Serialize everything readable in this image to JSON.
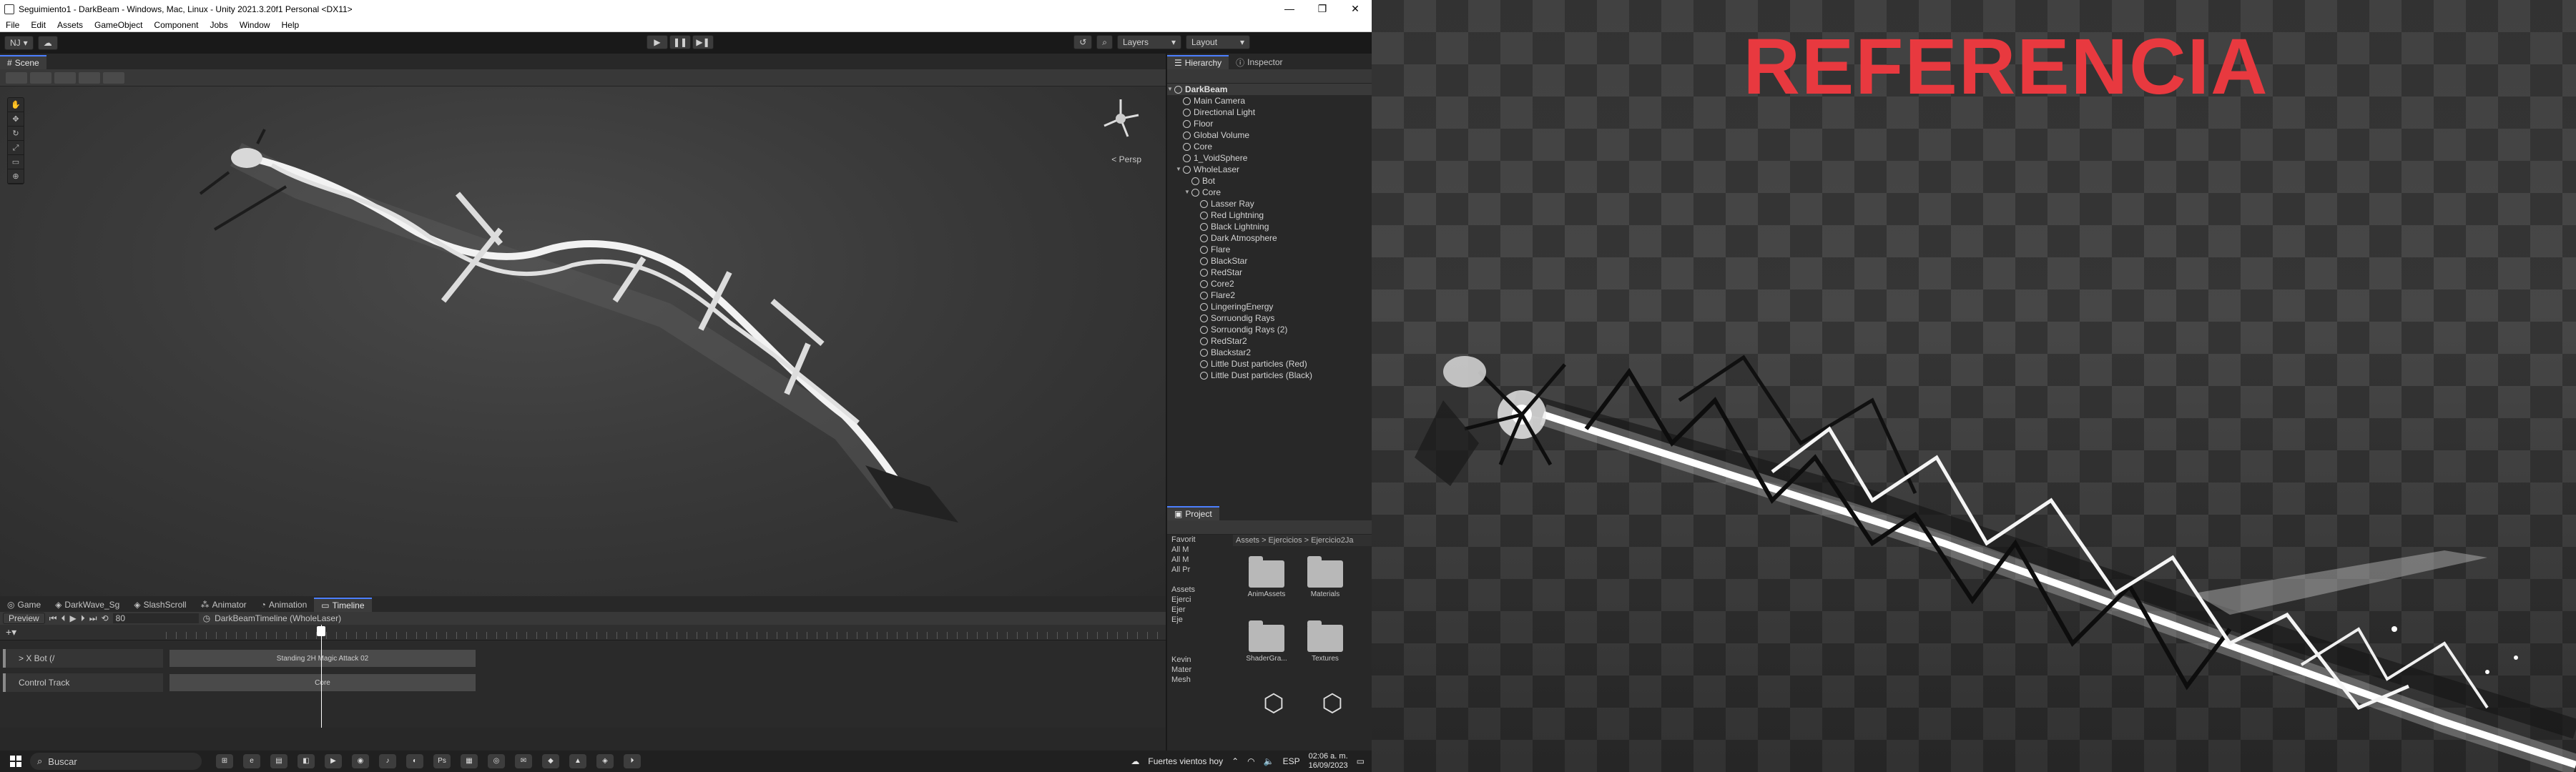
{
  "window": {
    "title": "Seguimiento1 - DarkBeam - Windows, Mac, Linux - Unity 2021.3.20f1 Personal <DX11>",
    "controls": [
      "—",
      "❐",
      "✕"
    ]
  },
  "menu": [
    "File",
    "Edit",
    "Assets",
    "GameObject",
    "Component",
    "Jobs",
    "Window",
    "Help"
  ],
  "toolbar": {
    "account": "NJ",
    "layers_label": "Layers",
    "layout_label": "Layout"
  },
  "scene": {
    "tab_label": "Scene",
    "persp_label": "< Persp"
  },
  "bottom_tabs": [
    "Game",
    "DarkWave_Sg",
    "SlashScroll",
    "Animator",
    "Animation",
    "Timeline"
  ],
  "timeline": {
    "preview_label": "Preview",
    "frame": "80",
    "asset_name": "DarkBeamTimeline (WholeLaser)",
    "tracks": [
      {
        "name": "> X Bot (/",
        "clip": "Standing 2H Magic Attack 02"
      },
      {
        "name": "Control Track",
        "clip": "Core"
      }
    ]
  },
  "hierarchy": {
    "tab_label": "Hierarchy",
    "inspector_label": "Inspector",
    "scene_name": "DarkBeam",
    "items": [
      {
        "label": "Main Camera",
        "indent": 1
      },
      {
        "label": "Directional Light",
        "indent": 1
      },
      {
        "label": "Floor",
        "indent": 1
      },
      {
        "label": "Global Volume",
        "indent": 1
      },
      {
        "label": "Core",
        "indent": 1
      },
      {
        "label": "1_VoidSphere",
        "indent": 1
      },
      {
        "label": "WholeLaser",
        "indent": 1,
        "expanded": true
      },
      {
        "label": "Bot",
        "indent": 2
      },
      {
        "label": "Core",
        "indent": 2,
        "expanded": true
      },
      {
        "label": "Lasser Ray",
        "indent": 3
      },
      {
        "label": "Red Lightning",
        "indent": 3
      },
      {
        "label": "Black Lightning",
        "indent": 3
      },
      {
        "label": "Dark Atmosphere",
        "indent": 3
      },
      {
        "label": "Flare",
        "indent": 3
      },
      {
        "label": "BlackStar",
        "indent": 3
      },
      {
        "label": "RedStar",
        "indent": 3
      },
      {
        "label": "Core2",
        "indent": 3
      },
      {
        "label": "Flare2",
        "indent": 3
      },
      {
        "label": "LingeringEnergy",
        "indent": 3
      },
      {
        "label": "Sorruondig Rays",
        "indent": 3
      },
      {
        "label": "Sorruondig Rays (2)",
        "indent": 3
      },
      {
        "label": "RedStar2",
        "indent": 3
      },
      {
        "label": "Blackstar2",
        "indent": 3
      },
      {
        "label": "Little Dust particles (Red)",
        "indent": 3
      },
      {
        "label": "Little Dust particles (Black)",
        "indent": 3
      }
    ]
  },
  "project": {
    "tab_label": "Project",
    "tree": [
      "Favorit",
      "All M",
      "All M",
      "All Pr",
      "",
      "Assets",
      "Ejerci",
      "Ejer",
      "Eje",
      "",
      "",
      "",
      "Kevin",
      "Mater",
      "Mesh"
    ],
    "breadcrumb": "Assets > Ejercicios > Ejercicio2Ja",
    "assets": [
      {
        "label": "AnimAssets",
        "kind": "folder"
      },
      {
        "label": "Materials",
        "kind": "folder"
      },
      {
        "label": "ShaderGra...",
        "kind": "folder"
      },
      {
        "label": "Textures",
        "kind": "folder"
      },
      {
        "label": "",
        "kind": "unity-asset"
      },
      {
        "label": "",
        "kind": "unity-asset"
      }
    ]
  },
  "taskbar": {
    "search_placeholder": "Buscar",
    "weather": "Fuertes vientos hoy",
    "lang": "ESP",
    "time": "02:06 a. m.",
    "date": "16/09/2023",
    "apps": [
      "⊞",
      "e",
      "▤",
      "◧",
      "▶",
      "◉",
      "♪",
      "◐",
      "Ps",
      "▦",
      "◎",
      "✉",
      "◆",
      "▲",
      "◈",
      "⏵"
    ]
  },
  "reference": {
    "title": "REFERENCIA"
  }
}
